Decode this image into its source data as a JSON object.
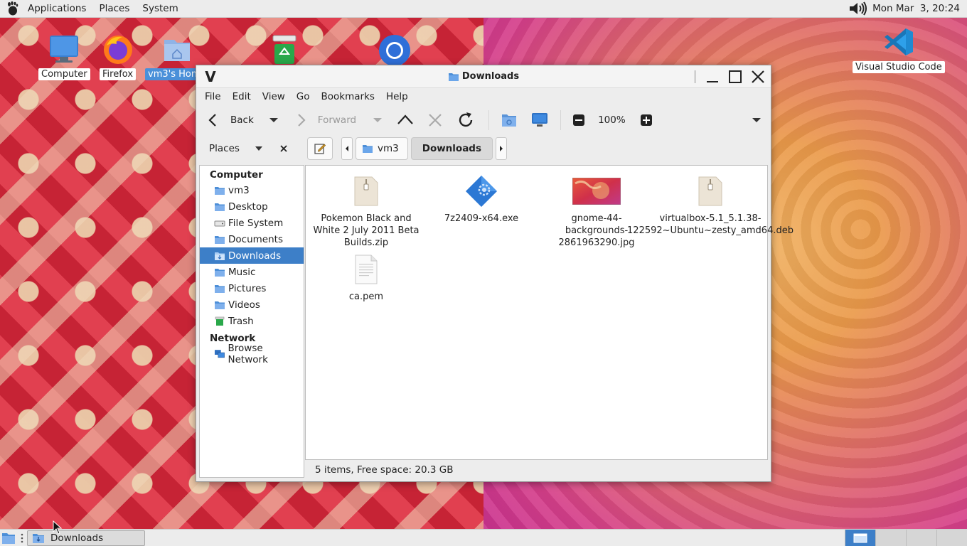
{
  "top_panel": {
    "menus": [
      "Applications",
      "Places",
      "System"
    ],
    "datetime": "Mon Mar  3, 20:24"
  },
  "desktop": {
    "icons": [
      {
        "label": "Computer"
      },
      {
        "label": "Firefox"
      },
      {
        "label": "vm3's Home"
      },
      {
        "label": "Visual Studio Code"
      }
    ]
  },
  "window": {
    "title": "Downloads",
    "menu": [
      "File",
      "Edit",
      "View",
      "Go",
      "Bookmarks",
      "Help"
    ],
    "toolbar": {
      "back": "Back",
      "forward": "Forward",
      "zoom": "100%"
    },
    "places_selector": "Places",
    "breadcrumbs": [
      "vm3",
      "Downloads"
    ],
    "sidebar": {
      "computer_heading": "Computer",
      "computer_items": [
        "vm3",
        "Desktop",
        "File System",
        "Documents",
        "Downloads",
        "Music",
        "Pictures",
        "Videos",
        "Trash"
      ],
      "network_heading": "Network",
      "network_items": [
        "Browse Network"
      ]
    },
    "files": [
      {
        "name": "Pokemon Black and White 2 July 2011 Beta Builds.zip",
        "icon": "archive-icon"
      },
      {
        "name": "7z2409-x64.exe",
        "icon": "executable-icon"
      },
      {
        "name": "gnome-44-backgrounds-2861963290.jpg",
        "icon": "image-thumbnail"
      },
      {
        "name": "virtualbox-5.1_5.1.38-122592~Ubuntu~zesty_amd64.deb",
        "icon": "package-icon"
      },
      {
        "name": "ca.pem",
        "icon": "text-file-icon"
      }
    ],
    "status": "5 items, Free space: 20.3 GB"
  },
  "bottom_panel": {
    "task": "Downloads"
  },
  "colors": {
    "selection": "#3d7fc8",
    "panel": "#ececec"
  }
}
